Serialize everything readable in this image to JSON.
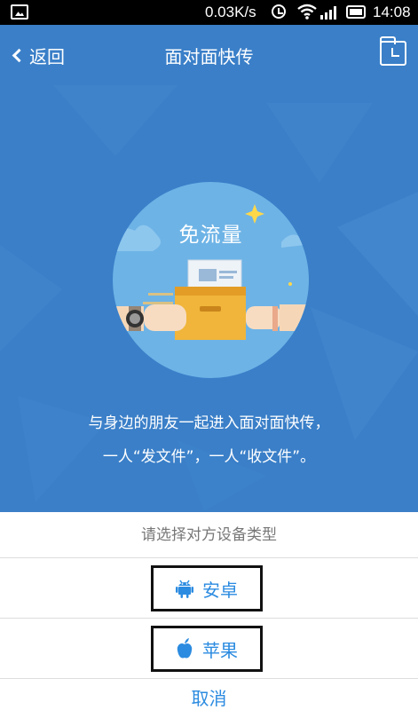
{
  "status_bar": {
    "network_speed": "0.03K/s",
    "time": "14:08"
  },
  "header": {
    "back_label": "返回",
    "title": "面对面快传"
  },
  "illustration": {
    "badge_text": "免流量"
  },
  "description": {
    "line1": "与身边的朋友一起进入面对面快传，",
    "line2": "一人“发文件”，一人“收文件”。"
  },
  "sheet": {
    "title": "请选择对方设备类型",
    "options": [
      {
        "label": "安卓",
        "icon": "android-icon"
      },
      {
        "label": "苹果",
        "icon": "apple-icon"
      }
    ],
    "cancel_label": "取消"
  },
  "colors": {
    "header_bg": "#3a7fc8",
    "circle_bg": "#6db3e6",
    "accent_blue": "#2b8be0"
  }
}
